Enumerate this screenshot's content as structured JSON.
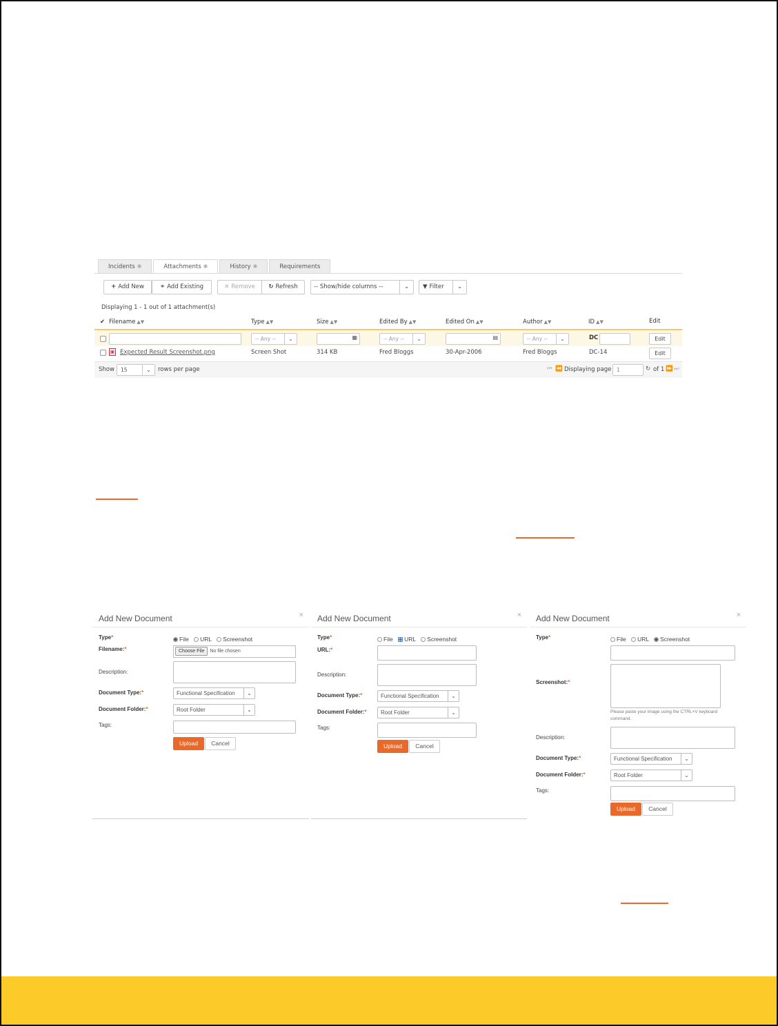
{
  "grid": {
    "tabs": [
      {
        "label": "Incidents",
        "badge": "✱"
      },
      {
        "label": "Attachments",
        "badge": "✱"
      },
      {
        "label": "History",
        "badge": "✱"
      },
      {
        "label": "Requirements",
        "badge": ""
      }
    ],
    "toolbar": {
      "add_new": "Add New",
      "add_existing": "Add Existing",
      "remove": "Remove",
      "refresh": "Refresh",
      "show_hide_columns": "-- Show/hide columns --",
      "filter": "Filter"
    },
    "display_count": "Displaying 1 - 1 out of 1 attachment(s)",
    "headers": {
      "filename": "Filename",
      "type": "Type",
      "size": "Size",
      "edited_by": "Edited By",
      "edited_on": "Edited On",
      "author": "Author",
      "id": "ID",
      "edit": "Edit"
    },
    "filters": {
      "any": "-- Any --",
      "id_prefix": "DC",
      "edit_button": "Edit"
    },
    "rows": [
      {
        "filename": "Expected Result Screenshot.png",
        "type": "Screen Shot",
        "size": "314 KB",
        "edited_by": "Fred Bloggs",
        "edited_on": "30-Apr-2006",
        "author": "Fred Bloggs",
        "id": "DC-14",
        "edit": "Edit"
      }
    ],
    "pager": {
      "show": "Show",
      "rows_value": "15",
      "rows_per_page": "rows per page",
      "displaying_page": "Displaying page",
      "page_value": "1",
      "of_pages": "of 1"
    }
  },
  "dialogs": [
    {
      "title": "Add New Document",
      "type_label": "Type",
      "options": [
        "File",
        "URL",
        "Screenshot"
      ],
      "selected": "File",
      "filename_label": "Filename:",
      "choose_file": "Choose File",
      "no_file": "No file chosen",
      "description_label": "Description:",
      "document_type_label": "Document Type:",
      "document_type_value": "Functional Specification",
      "document_folder_label": "Document Folder:",
      "document_folder_value": "Root Folder",
      "tags_label": "Tags:",
      "upload": "Upload",
      "cancel": "Cancel"
    },
    {
      "title": "Add New Document",
      "type_label": "Type",
      "options": [
        "File",
        "URL",
        "Screenshot"
      ],
      "selected": "URL",
      "url_label": "URL:",
      "description_label": "Description:",
      "document_type_label": "Document Type:",
      "document_type_value": "Functional Specification",
      "document_folder_label": "Document Folder:",
      "document_folder_value": "Root Folder",
      "tags_label": "Tags:",
      "upload": "Upload",
      "cancel": "Cancel"
    },
    {
      "title": "Add New Document",
      "type_label": "Type",
      "options": [
        "File",
        "URL",
        "Screenshot"
      ],
      "selected": "Screenshot",
      "screenshot_label": "Screenshot:",
      "paste_hint": "Please paste your image using the CTRL+V keyboard command.",
      "description_label": "Description:",
      "document_type_label": "Document Type:",
      "document_type_value": "Functional Specification",
      "document_folder_label": "Document Folder:",
      "document_folder_value": "Root Folder",
      "tags_label": "Tags:",
      "upload": "Upload",
      "cancel": "Cancel"
    }
  ],
  "close_symbol": "×",
  "colors": {
    "accent_orange": "#e8692a",
    "footer_yellow": "#fccb2a",
    "filter_row_bg": "#fdf7e5"
  }
}
